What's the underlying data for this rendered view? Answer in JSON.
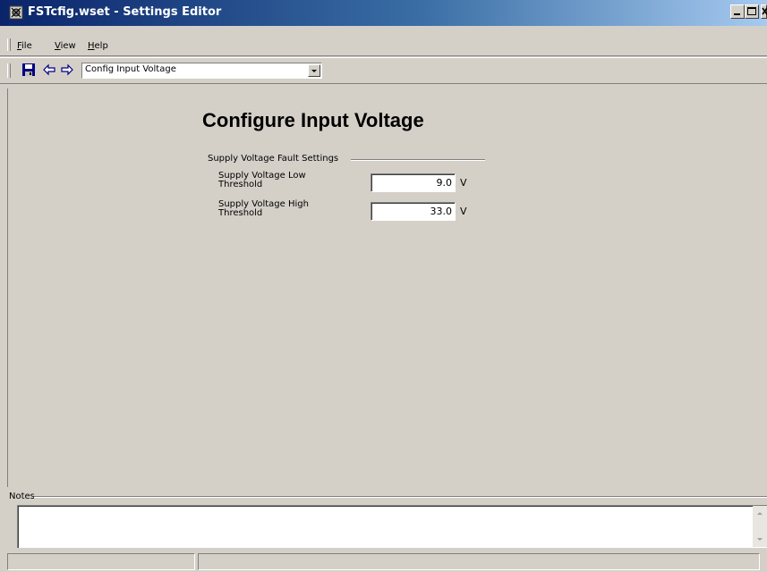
{
  "window": {
    "title": "FSTcfig.wset - Settings Editor",
    "controls": [
      "minimize-icon",
      "maximize-icon",
      "close-icon"
    ]
  },
  "menu": {
    "items": [
      {
        "label": "File",
        "accel": "F",
        "rest": "ile"
      },
      {
        "label": "View",
        "accel": "V",
        "rest": "iew"
      },
      {
        "label": "Help",
        "accel": "H",
        "rest": "elp"
      }
    ]
  },
  "toolbar": {
    "icons": [
      "save-icon",
      "back-arrow-icon",
      "forward-arrow-icon"
    ],
    "page_select": {
      "value": "Config Input Voltage"
    }
  },
  "main": {
    "title": "Configure Input Voltage",
    "group": {
      "label": "Supply Voltage Fault Settings",
      "fields": [
        {
          "label_line1": "Supply Voltage Low",
          "label_line2": "Threshold",
          "value": "9.0",
          "unit": "V"
        },
        {
          "label_line1": "Supply Voltage High",
          "label_line2": "Threshold",
          "value": "33.0",
          "unit": "V"
        }
      ]
    }
  },
  "notes": {
    "label": "Notes",
    "value": ""
  },
  "colors": {
    "titlebar_start": "#0a246a",
    "titlebar_end": "#a6caf0",
    "face": "#d4d0c8"
  }
}
